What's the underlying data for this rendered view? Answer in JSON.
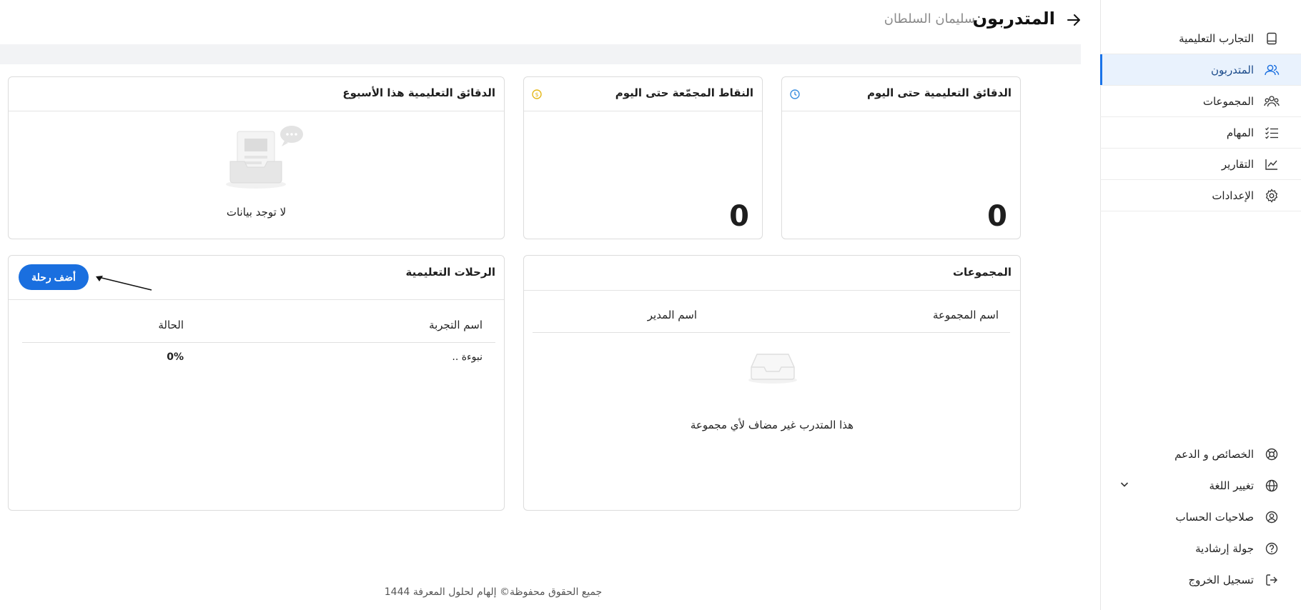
{
  "header": {
    "title": "المتدربون",
    "trainee_name": "سليمان السلطان"
  },
  "sidebar": {
    "items": [
      {
        "label": "التجارب التعليمية",
        "icon": "tablet-icon",
        "active": false
      },
      {
        "label": "المتدربون",
        "icon": "users-icon",
        "active": true
      },
      {
        "label": "المجموعات",
        "icon": "group-icon",
        "active": false
      },
      {
        "label": "المهام",
        "icon": "checklist-icon",
        "active": false
      },
      {
        "label": "التقارير",
        "icon": "chart-line-icon",
        "active": false
      },
      {
        "label": "الإعدادات",
        "icon": "gear-icon",
        "active": false
      }
    ],
    "bottom_items": [
      {
        "label": "الخصائص و الدعم",
        "icon": "lifebuoy-icon"
      },
      {
        "label": "تغيير اللغة",
        "icon": "globe-icon"
      },
      {
        "label": "صلاحيات الحساب",
        "icon": "user-circle-icon"
      },
      {
        "label": "جولة إرشادية",
        "icon": "help-icon"
      },
      {
        "label": "تسجيل الخروج",
        "icon": "logout-icon"
      }
    ]
  },
  "stats": {
    "minutes_today": {
      "title": "الدقائق التعليمية حتى اليوم",
      "value": "0",
      "icon": "clock-icon",
      "icon_color": "#3b8fe0"
    },
    "points_today": {
      "title": "النقاط المجمّعة حتى اليوم",
      "value": "0",
      "icon": "coin-icon",
      "icon_color": "#e5b81a"
    },
    "minutes_week": {
      "title": "الدقائق التعليمية هذا الأسبوع",
      "empty_text": "لا توجد بيانات"
    }
  },
  "groups_card": {
    "title": "المجموعات",
    "columns": [
      "اسم المجموعة",
      "اسم المدير"
    ],
    "empty_text": "هذا المتدرب غير مضاف لأي مجموعة"
  },
  "journeys_card": {
    "title": "الرحلات التعليمية",
    "add_button": "أضف رحلة",
    "columns": [
      "اسم التجربة",
      "الحالة"
    ],
    "rows": [
      {
        "name": "نبوءة ..",
        "status": "0%"
      }
    ]
  },
  "footer": {
    "text": "جميع الحقوق محفوظة© إلهام لحلول المعرفة 1444"
  },
  "colors": {
    "accent": "#1a6fdf",
    "active_bg": "#e9f2fd",
    "page_bg": "#f2f3f5"
  }
}
